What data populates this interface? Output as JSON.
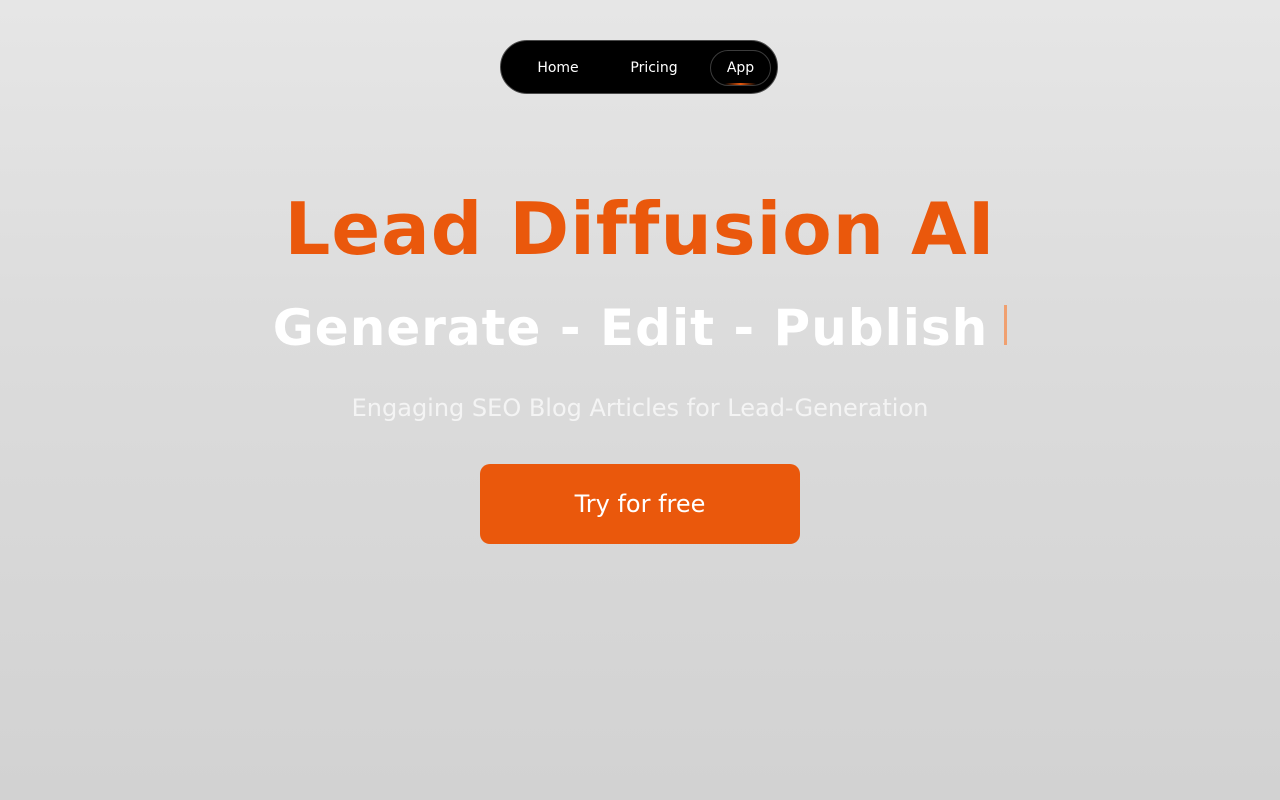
{
  "nav": {
    "items": [
      {
        "label": "Home"
      },
      {
        "label": "Pricing"
      },
      {
        "label": "App",
        "active": true
      }
    ]
  },
  "hero": {
    "title": "Lead Diffusion AI",
    "subtitle": "Generate - Edit - Publish",
    "tagline": "Engaging SEO Blog Articles for Lead-Generation",
    "cta_label": "Try for free"
  },
  "colors": {
    "accent": "#ea580c",
    "nav_background": "#000000",
    "page_background": "#dcdcdc",
    "text_light": "#ffffff"
  }
}
